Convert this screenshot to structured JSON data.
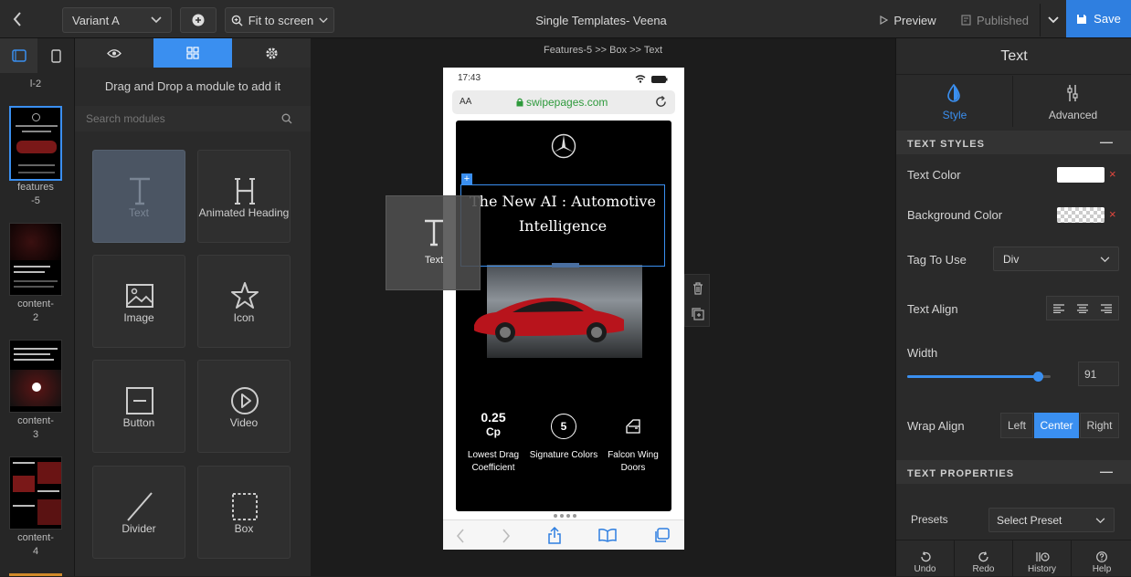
{
  "topbar": {
    "variant": "Variant A",
    "zoom": "Fit to screen",
    "title": "Single Templates- Veena",
    "preview": "Preview",
    "published": "Published",
    "save": "Save"
  },
  "left_rail": {
    "partial_label": "l-2",
    "thumbnails": [
      {
        "label_line1": "features",
        "label_line2": "-5"
      },
      {
        "label_line1": "content-",
        "label_line2": "2"
      },
      {
        "label_line1": "content-",
        "label_line2": "3"
      },
      {
        "label_line1": "content-",
        "label_line2": "4"
      }
    ]
  },
  "module_panel": {
    "hint": "Drag and Drop a module to add it",
    "search_placeholder": "Search modules",
    "modules": [
      {
        "label": "Text",
        "icon": "text-icon"
      },
      {
        "label": "Animated Heading",
        "icon": "animated-heading-icon"
      },
      {
        "label": "Image",
        "icon": "image-icon"
      },
      {
        "label": "Icon",
        "icon": "star-icon"
      },
      {
        "label": "Button",
        "icon": "button-icon"
      },
      {
        "label": "Video",
        "icon": "play-icon"
      },
      {
        "label": "Divider",
        "icon": "divider-icon"
      },
      {
        "label": "Box",
        "icon": "box-icon"
      }
    ]
  },
  "canvas": {
    "breadcrumb": "Features-5 >> Box >> Text",
    "drag_ghost_label": "Text",
    "phone": {
      "time": "17:43",
      "url_aa": "AA",
      "url": "swipepages.com",
      "headline": "The New AI : Automotive Intelligence",
      "features": [
        {
          "value": "0.25",
          "sub": "Cp",
          "label": "Lowest Drag Coefficient"
        },
        {
          "value": "5",
          "label": "Signature Colors"
        },
        {
          "label": "Falcon Wing Doors"
        }
      ]
    }
  },
  "right_panel": {
    "title": "Text",
    "tab_style": "Style",
    "tab_advanced": "Advanced",
    "section_text_styles": "TEXT STYLES",
    "text_color_label": "Text Color",
    "bg_color_label": "Background Color",
    "tag_label": "Tag To Use",
    "tag_value": "Div",
    "align_label": "Text Align",
    "width_label": "Width",
    "width_value": "91",
    "width_fraction": 0.91,
    "wrap_label": "Wrap Align",
    "wrap_left": "Left",
    "wrap_center": "Center",
    "wrap_right": "Right",
    "section_text_props": "TEXT PROPERTIES",
    "presets_label": "Presets",
    "presets_value": "Select Preset",
    "bottom": {
      "undo": "Undo",
      "redo": "Redo",
      "history": "History",
      "help": "Help"
    }
  },
  "colors": {
    "accent": "#3a8ff0",
    "save": "#2f7fe0",
    "delete": "#e5483f"
  }
}
